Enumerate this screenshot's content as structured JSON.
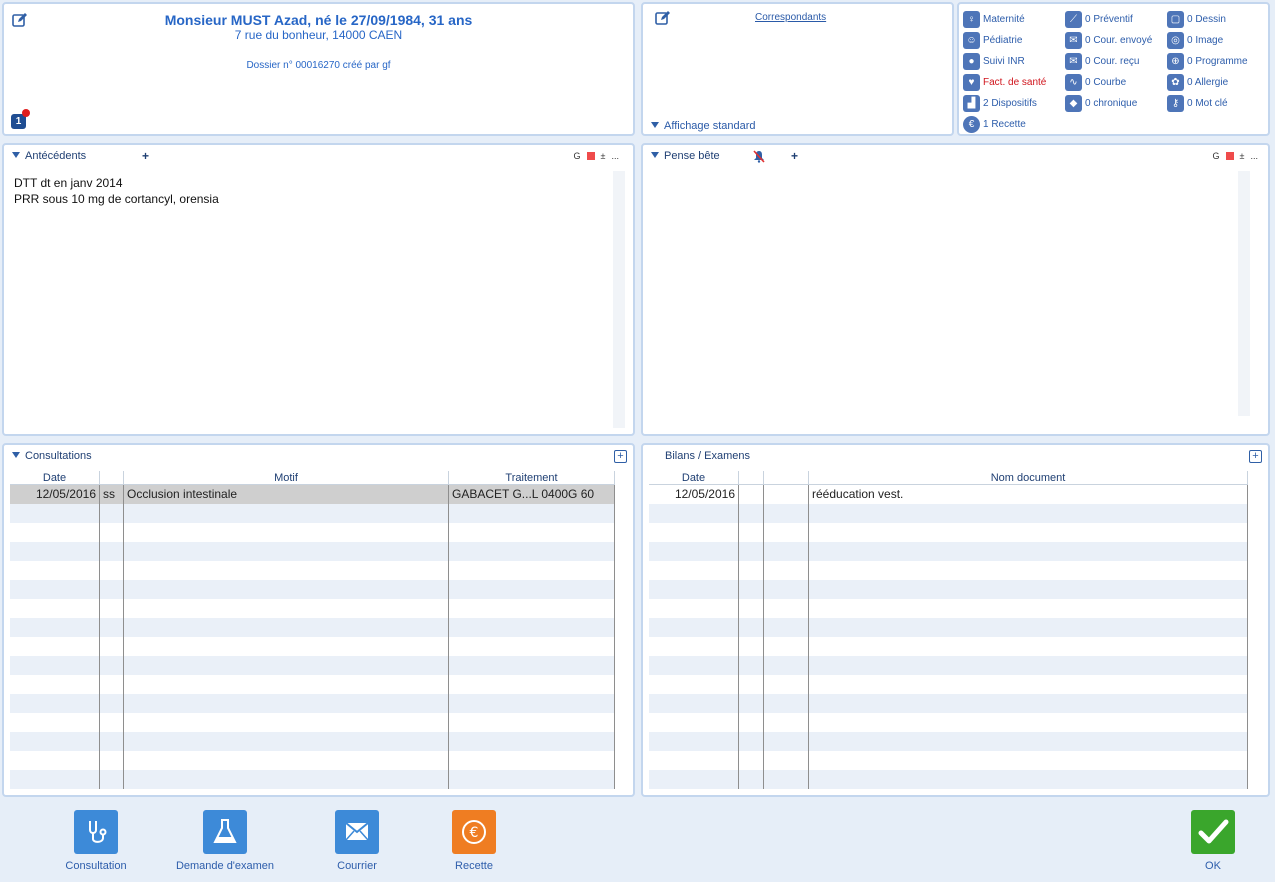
{
  "header": {
    "name": "Monsieur MUST Azad, né le 27/09/1984, 31 ans",
    "address": "7 rue du bonheur, 14000 CAEN",
    "dossier": "Dossier n° 00016270 créé par gf",
    "badge_count": "1"
  },
  "correspondants": {
    "link": "Correspondants",
    "affichage": "Affichage standard"
  },
  "shortcuts": [
    {
      "label": "Maternité",
      "icon": "maternity-icon"
    },
    {
      "label": "Pédiatrie",
      "icon": "pediatrics-icon"
    },
    {
      "label": "Suivi INR",
      "icon": "drop-icon"
    },
    {
      "label": "Fact. de santé",
      "icon": "heart-icon",
      "color": "#d0141c"
    },
    {
      "label": "2 Dispositifs",
      "icon": "stairs-icon"
    },
    {
      "label": "1 Recette",
      "icon": "euro-icon"
    },
    {
      "label": "0 Préventif",
      "icon": "syringe-icon"
    },
    {
      "label": "0 Cour. envoyé",
      "icon": "envelope-icon"
    },
    {
      "label": "0 Cour. reçu",
      "icon": "inbox-icon"
    },
    {
      "label": "0 Courbe",
      "icon": "chart-icon"
    },
    {
      "label": "0 chronique",
      "icon": "pill-icon"
    },
    {
      "label": "0 Dessin",
      "icon": "drawing-icon"
    },
    {
      "label": "0 Image",
      "icon": "camera-icon"
    },
    {
      "label": "0 Programme",
      "icon": "program-icon"
    },
    {
      "label": "0 Allergie",
      "icon": "allergy-icon"
    },
    {
      "label": "0 Mot clé",
      "icon": "key-icon"
    }
  ],
  "antecedents": {
    "title": "Antécédents",
    "tool_g": "G",
    "tool_pm": "±",
    "tool_more": "...",
    "lines": [
      "DTT dt en janv 2014",
      "PRR sous 10 mg de cortancyl, orensia"
    ]
  },
  "pense_bete": {
    "title": "Pense bête",
    "tool_g": "G",
    "tool_pm": "±",
    "tool_more": "..."
  },
  "consultations": {
    "title": "Consultations",
    "columns": [
      "Date",
      "",
      "Motif",
      "Traitement"
    ],
    "rows": [
      {
        "date": "12/05/2016",
        "code": "ss",
        "motif": "Occlusion intestinale",
        "traitement": "GABACET G...L 0400G 60"
      }
    ]
  },
  "bilans": {
    "title": "Bilans / Examens",
    "columns": [
      "Date",
      "",
      "",
      "Nom document"
    ],
    "rows": [
      {
        "date": "12/05/2016",
        "nom": "rééducation vest."
      }
    ]
  },
  "toolbar": [
    {
      "label": "Consultation",
      "color": "#3d8ad8"
    },
    {
      "label": "Demande d'examen",
      "color": "#3d8ad8"
    },
    {
      "label": "Courrier",
      "color": "#3d8ad8"
    },
    {
      "label": "Recette",
      "color": "#ef7d22"
    }
  ],
  "ok": {
    "label": "OK",
    "color": "#3aa62c"
  }
}
